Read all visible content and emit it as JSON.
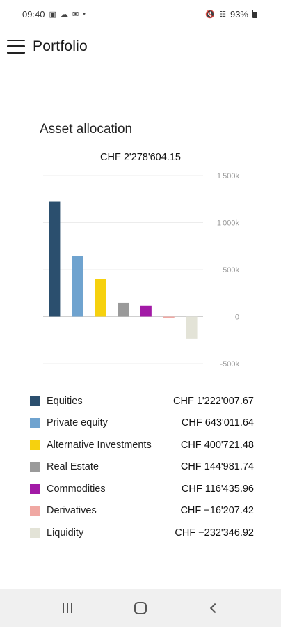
{
  "status_bar": {
    "time": "09:40",
    "battery": "93%"
  },
  "app_bar": {
    "title": "Portfolio"
  },
  "section": {
    "title": "Asset allocation",
    "total": "CHF 2'278'604.15"
  },
  "legend": [
    {
      "name": "Equities",
      "value": "CHF 1'222'007.67",
      "color": "#2b4f6e"
    },
    {
      "name": "Private equity",
      "value": "CHF 643'011.64",
      "color": "#6fa3cf"
    },
    {
      "name": "Alternative Investments",
      "value": "CHF 400'721.48",
      "color": "#f6d10e"
    },
    {
      "name": "Real Estate",
      "value": "CHF 144'981.74",
      "color": "#9a9a9a"
    },
    {
      "name": "Commodities",
      "value": "CHF 116'435.96",
      "color": "#a21aa6"
    },
    {
      "name": "Derivatives",
      "value": "CHF −16'207.42",
      "color": "#f0a8a3"
    },
    {
      "name": "Liquidity",
      "value": "CHF −232'346.92",
      "color": "#e3e3d7"
    }
  ],
  "chart_data": {
    "type": "bar",
    "title": "",
    "xlabel": "",
    "ylabel": "",
    "ylim": [
      -500000,
      1500000
    ],
    "y_ticks": [
      1500000,
      1000000,
      500000,
      0,
      -500000
    ],
    "y_tick_labels": [
      "1 500k",
      "1 000k",
      "500k",
      "0",
      "-500k"
    ],
    "categories": [
      "Equities",
      "Private equity",
      "Alternative Investments",
      "Real Estate",
      "Commodities",
      "Derivatives",
      "Liquidity"
    ],
    "values": [
      1222007.67,
      643011.64,
      400721.48,
      144981.74,
      116435.96,
      -16207.42,
      -232346.92
    ],
    "colors": [
      "#2b4f6e",
      "#6fa3cf",
      "#f6d10e",
      "#9a9a9a",
      "#a21aa6",
      "#f0a8a3",
      "#e3e3d7"
    ],
    "grid": true
  },
  "nav_bar": {
    "recents_icon": "recents-icon",
    "home_icon": "home-icon",
    "back_icon": "back-icon"
  }
}
